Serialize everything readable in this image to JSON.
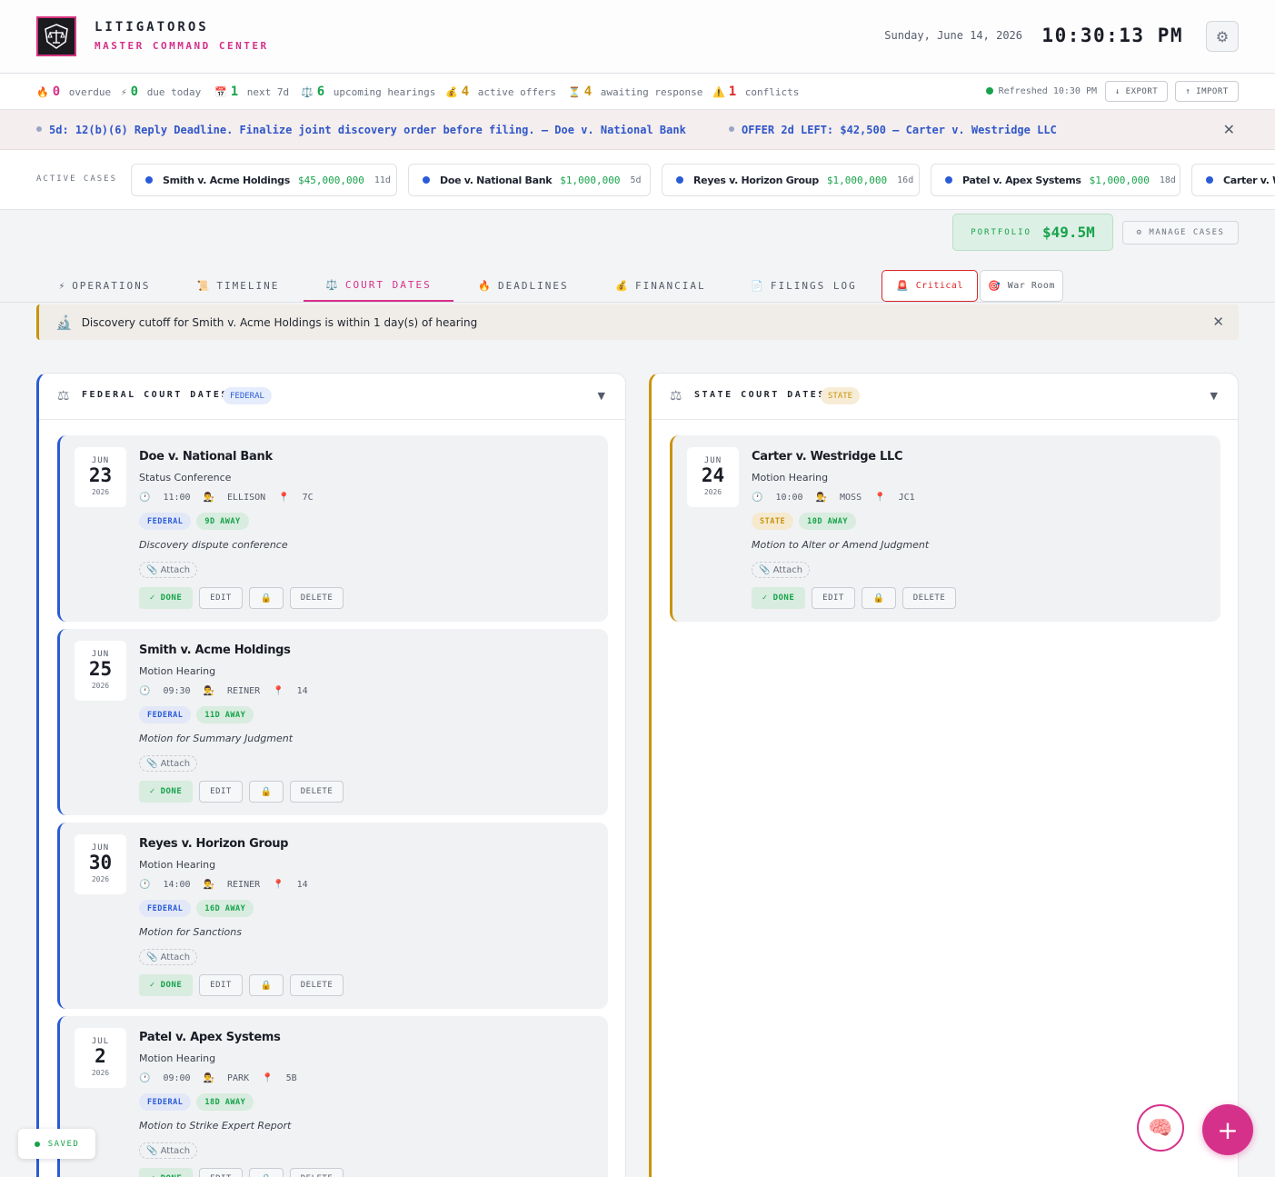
{
  "header": {
    "brand_title": "LITIGATOROS",
    "brand_subtitle": "MASTER COMMAND CENTER",
    "date": "Sunday, June 14, 2026",
    "time": "10:30:13 PM",
    "settings_icon": "gear-icon",
    "logo_icon": "scales-shield-icon",
    "accent_color": "#d6318a"
  },
  "stats": [
    {
      "icon": "🔥",
      "value": "0",
      "label": "overdue",
      "color": "#d6318a"
    },
    {
      "icon": "⚡",
      "value": "0",
      "label": "due today",
      "color": "#16a34a"
    },
    {
      "icon": "📅",
      "value": "1",
      "label": "next 7d",
      "color": "#16a34a"
    },
    {
      "icon": "⚖️",
      "value": "6",
      "label": "upcoming hearings",
      "color": "#16a34a"
    },
    {
      "icon": "💰",
      "value": "4",
      "label": "active offers",
      "color": "#c9940c"
    },
    {
      "icon": "⏳",
      "value": "4",
      "label": "awaiting response",
      "color": "#c9940c"
    },
    {
      "icon": "⚠️",
      "value": "1",
      "label": "conflicts",
      "color": "#dc2626"
    }
  ],
  "refreshed": "Refreshed 10:30 PM",
  "export_label": "↓ EXPORT",
  "import_label": "↑ IMPORT",
  "ticker": [
    "5d: 12(b)(6) Reply Deadline. Finalize joint discovery order before filing. — Doe v. National Bank",
    "OFFER 2d LEFT: $42,500 — Carter v. Westridge LLC"
  ],
  "ticker_close": "✕",
  "active_cases_label": "ACTIVE CASES",
  "active_cases": [
    {
      "name": "Smith v. Acme Holdings",
      "amount": "$45,000,000",
      "days": "11d"
    },
    {
      "name": "Doe v. National Bank",
      "amount": "$1,000,000",
      "days": "5d"
    },
    {
      "name": "Reyes v. Horizon Group",
      "amount": "$1,000,000",
      "days": "16d"
    },
    {
      "name": "Patel v. Apex Systems",
      "amount": "$1,000,000",
      "days": "18d"
    },
    {
      "name": "Carter v. W",
      "amount": "",
      "days": ""
    }
  ],
  "portfolio": {
    "label": "PORTFOLIO",
    "value": "$49.5M"
  },
  "manage_cases": "⚙ MANAGE CASES",
  "tabs": [
    {
      "icon": "⚡",
      "label": "OPERATIONS"
    },
    {
      "icon": "📜",
      "label": "TIMELINE"
    },
    {
      "icon": "⚖️",
      "label": "COURT DATES"
    },
    {
      "icon": "🔥",
      "label": "DEADLINES"
    },
    {
      "icon": "💰",
      "label": "FINANCIAL"
    },
    {
      "icon": "📄",
      "label": "FILINGS LOG"
    },
    {
      "icon": "🚨",
      "label": "Critical"
    },
    {
      "icon": "🎯",
      "label": "War Room"
    }
  ],
  "active_tab": "COURT DATES",
  "alert": {
    "icon": "microscope-icon",
    "text": "Discovery cutoff for Smith v. Acme Holdings is within 1 day(s) of hearing",
    "close": "✕"
  },
  "federal": {
    "title": "FEDERAL COURT DATES",
    "tag": "FEDERAL",
    "cards": [
      {
        "month": "JUN",
        "day": "23",
        "year": "2026",
        "case": "Doe v. National Bank",
        "type": "Status Conference",
        "time": "11:00",
        "judge": "ELLISON",
        "room": "7C",
        "court_tag": "FEDERAL",
        "away": "9D AWAY",
        "desc": "Discovery dispute conference"
      },
      {
        "month": "JUN",
        "day": "25",
        "year": "2026",
        "case": "Smith v. Acme Holdings",
        "type": "Motion Hearing",
        "time": "09:30",
        "judge": "REINER",
        "room": "14",
        "court_tag": "FEDERAL",
        "away": "11D AWAY",
        "desc": "Motion for Summary Judgment"
      },
      {
        "month": "JUN",
        "day": "30",
        "year": "2026",
        "case": "Reyes v. Horizon Group",
        "type": "Motion Hearing",
        "time": "14:00",
        "judge": "REINER",
        "room": "14",
        "court_tag": "FEDERAL",
        "away": "16D AWAY",
        "desc": "Motion for Sanctions"
      },
      {
        "month": "JUL",
        "day": "2",
        "year": "2026",
        "case": "Patel v. Apex Systems",
        "type": "Motion Hearing",
        "time": "09:00",
        "judge": "PARK",
        "room": "5B",
        "court_tag": "FEDERAL",
        "away": "18D AWAY",
        "desc": "Motion to Strike Expert Report"
      }
    ]
  },
  "state": {
    "title": "STATE COURT DATES",
    "tag": "STATE",
    "cards": [
      {
        "month": "JUN",
        "day": "24",
        "year": "2026",
        "case": "Carter v. Westridge LLC",
        "type": "Motion Hearing",
        "time": "10:00",
        "judge": "MOSS",
        "room": "JC1",
        "court_tag": "STATE",
        "away": "10D AWAY",
        "desc": "Motion to Alter or Amend Judgment"
      }
    ]
  },
  "card_actions": {
    "attach": "📎 Attach",
    "done": "✓ DONE",
    "edit": "EDIT",
    "lock": "🔒",
    "delete": "DELETE"
  },
  "saved": "SAVED",
  "fab_label": "+",
  "brain_icon": "🧠",
  "colors": {
    "federal": "#2a5bd7",
    "state": "#c9940c",
    "success": "#16a34a",
    "critical": "#dc2626"
  }
}
